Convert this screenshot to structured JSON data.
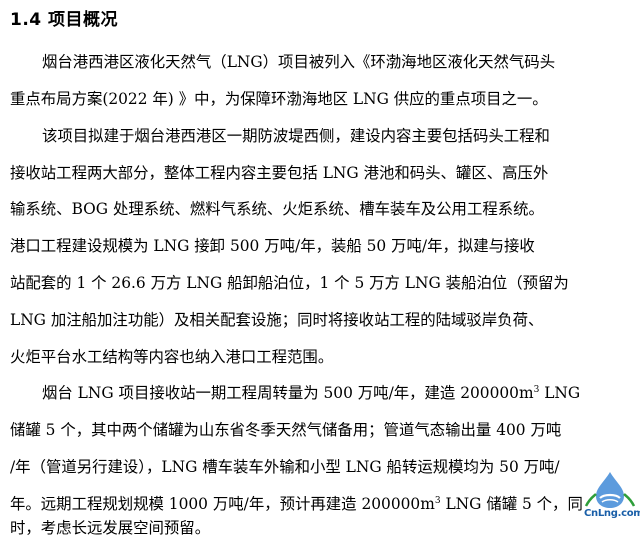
{
  "section": {
    "heading": "1.4 项目概况"
  },
  "paragraphs": {
    "p1": {
      "l1": "烟台港西港区液化天然气（LNG）项目被列入《环渤海地区液化天然气码头",
      "l2": "重点布局方案(2022 年) 》中，为保障环渤海地区 LNG 供应的重点项目之一。"
    },
    "p2": {
      "l1": "该项目拟建于烟台港西港区一期防波堤西侧，建设内容主要包括码头工程和",
      "l2": "接收站工程两大部分，整体工程内容主要包括 LNG 港池和码头、罐区、高压外",
      "l3": "输系统、BOG 处理系统、燃料气系统、火炬系统、槽车装车及公用工程系统。"
    },
    "p3": {
      "l1": "港口工程建设规模为 LNG 接卸 500 万吨/年，装船 50 万吨/年，拟建与接收",
      "l2": "站配套的 1 个 26.6 万方 LNG 船卸船泊位，1 个 5 万方 LNG 装船泊位（预留为",
      "l3": "LNG 加注船加注功能）及相关配套设施；同时将接收站工程的陆域驳岸负荷、",
      "l4": "火炬平台水工结构等内容也纳入港口工程范围。"
    },
    "p4": {
      "l1a": "烟台 LNG 项目接收站一期工程周转量为 500 万吨/年，建造 200000m",
      "l1sup": "3",
      "l1b": " LNG",
      "l2": "储罐 5 个，其中两个储罐为山东省冬季天然气储备用；管道气态输出量 400 万吨",
      "l3": "/年（管道另行建设），LNG 槽车装车外输和小型 LNG 船转运规模均为 50 万吨/",
      "l4a": "年。远期工程规划规模 1000 万吨/年，预计再建造 200000m",
      "l4sup": "3",
      "l4b": " LNG 储罐 5 个，同",
      "l5": "时，考虑长远发展空间预留。"
    }
  },
  "watermark": {
    "text": "CnLng.com"
  },
  "colors": {
    "text": "#000000",
    "logo_blue": "#1a5fa8",
    "logo_green": "#2e9e3a"
  }
}
